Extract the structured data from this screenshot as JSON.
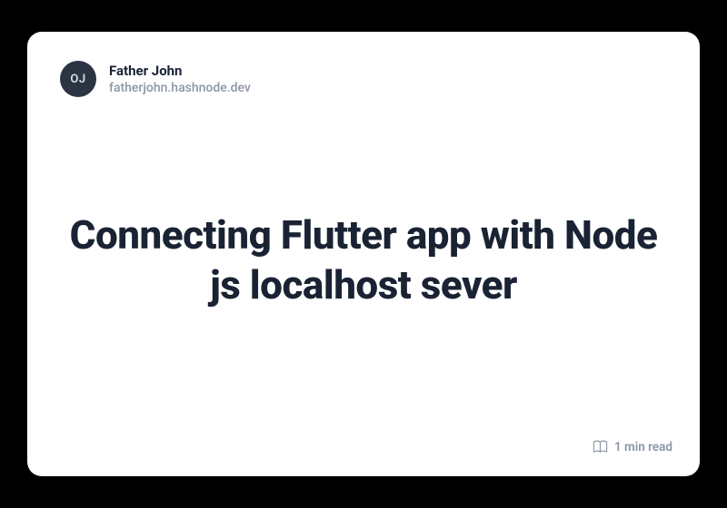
{
  "author": {
    "initials": "OJ",
    "name": "Father John",
    "domain": "fatherjohn.hashnode.dev"
  },
  "post": {
    "title": "Connecting Flutter app with Node js localhost sever",
    "read_time": "1 min read"
  }
}
